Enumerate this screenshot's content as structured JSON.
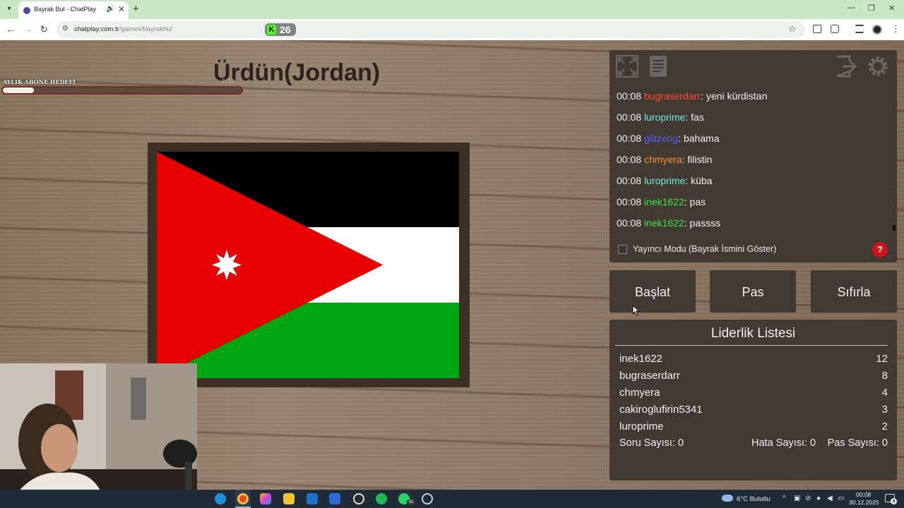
{
  "browser": {
    "tab_title": "Bayrak Bul - ChatPlay",
    "url_host": "chatplay.com.tr",
    "url_path": "/games/bayrakbul",
    "extension_count": "26",
    "extension_letter": "K",
    "extension_color": "#53fc18"
  },
  "game": {
    "country_title": "Ürdün(Jordan)",
    "goal": {
      "label": "AYLIK ABONE HEDEFİ",
      "count": "2 / 15",
      "progress": 0.13
    },
    "flag": {
      "country": "Jordan",
      "colors": {
        "black": "#000000",
        "white": "#ffffff",
        "green": "#00a612",
        "red": "#e60000"
      }
    }
  },
  "chat": {
    "messages": [
      {
        "time": "00:08",
        "user": "bugraserdarr",
        "color": "#ff4a2a",
        "text": "yeni kürdistan"
      },
      {
        "time": "00:08",
        "user": "luroprime",
        "color": "#6fe8e0",
        "text": "fas"
      },
      {
        "time": "00:08",
        "user": "glitzerig",
        "color": "#5b5cff",
        "text": "bahama"
      },
      {
        "time": "00:08",
        "user": "chmyera",
        "color": "#ff8c3a",
        "text": "filistin"
      },
      {
        "time": "00:08",
        "user": "luroprime",
        "color": "#6fe8e0",
        "text": "küba"
      },
      {
        "time": "00:08",
        "user": "inek1622",
        "color": "#3ee04a",
        "text": "pas"
      },
      {
        "time": "00:08",
        "user": "inek1622",
        "color": "#3ee04a",
        "text": "passss"
      }
    ],
    "streamer_mode_label": "Yayıncı Modu (Bayrak İsmini Göster)",
    "help_label": "?",
    "icons": [
      "fullscreen-icon",
      "document-icon",
      "exit-icon",
      "settings-icon"
    ]
  },
  "actions": {
    "start": "Başlat",
    "pass": "Pas",
    "reset": "Sıfırla"
  },
  "leaderboard": {
    "title": "Liderlik Listesi",
    "rows": [
      {
        "name": "inek1622",
        "score": "12"
      },
      {
        "name": "bugraserdarr",
        "score": "8"
      },
      {
        "name": "chmyera",
        "score": "4"
      },
      {
        "name": "cakiroglufirin5341",
        "score": "3"
      },
      {
        "name": "luroprime",
        "score": "2"
      }
    ],
    "stats": {
      "questions": "Soru Sayısı: 0",
      "errors": "Hata Sayısı: 0",
      "passes": "Pas Sayısı: 0"
    }
  },
  "taskbar": {
    "weather": "6°C  Bulutlu",
    "time": "00:08",
    "date": "30.12.2025",
    "whatsapp_badge": "55",
    "notification_count": "4"
  }
}
